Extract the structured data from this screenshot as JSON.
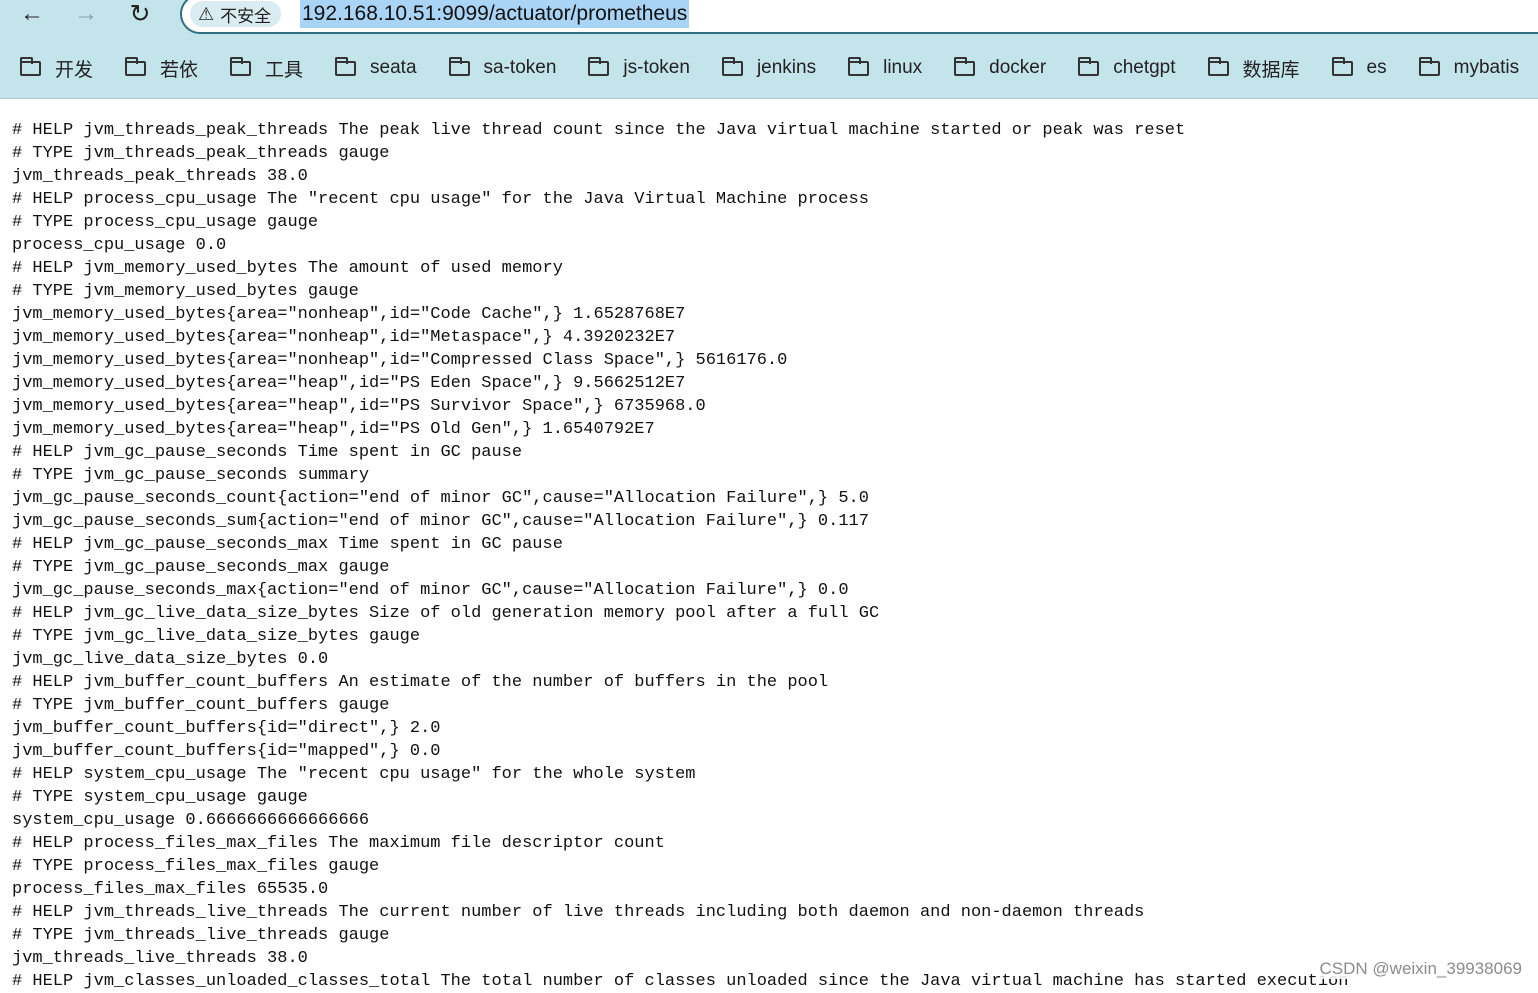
{
  "browser": {
    "url": "192.168.10.51:9099/actuator/prometheus",
    "security_label": "不安全",
    "bookmarks": [
      "开发",
      "若依",
      "工具",
      "seata",
      "sa-token",
      "js-token",
      "jenkins",
      "linux",
      "docker",
      "chetgpt",
      "数据库",
      "es",
      "mybatis"
    ]
  },
  "icons": {
    "back": "arrow-left-icon",
    "forward": "arrow-right-icon",
    "reload": "reload-icon",
    "security": "warning-triangle-icon",
    "bookmark": "folder-icon"
  },
  "colors": {
    "chrome_bg": "#c4e4ec",
    "omnibox_border": "#2f6e80",
    "url_selection": "#aad4f5"
  },
  "metrics_lines": [
    "# HELP jvm_threads_peak_threads The peak live thread count since the Java virtual machine started or peak was reset",
    "# TYPE jvm_threads_peak_threads gauge",
    "jvm_threads_peak_threads 38.0",
    "# HELP process_cpu_usage The \"recent cpu usage\" for the Java Virtual Machine process",
    "# TYPE process_cpu_usage gauge",
    "process_cpu_usage 0.0",
    "# HELP jvm_memory_used_bytes The amount of used memory",
    "# TYPE jvm_memory_used_bytes gauge",
    "jvm_memory_used_bytes{area=\"nonheap\",id=\"Code Cache\",} 1.6528768E7",
    "jvm_memory_used_bytes{area=\"nonheap\",id=\"Metaspace\",} 4.3920232E7",
    "jvm_memory_used_bytes{area=\"nonheap\",id=\"Compressed Class Space\",} 5616176.0",
    "jvm_memory_used_bytes{area=\"heap\",id=\"PS Eden Space\",} 9.5662512E7",
    "jvm_memory_used_bytes{area=\"heap\",id=\"PS Survivor Space\",} 6735968.0",
    "jvm_memory_used_bytes{area=\"heap\",id=\"PS Old Gen\",} 1.6540792E7",
    "# HELP jvm_gc_pause_seconds Time spent in GC pause",
    "# TYPE jvm_gc_pause_seconds summary",
    "jvm_gc_pause_seconds_count{action=\"end of minor GC\",cause=\"Allocation Failure\",} 5.0",
    "jvm_gc_pause_seconds_sum{action=\"end of minor GC\",cause=\"Allocation Failure\",} 0.117",
    "# HELP jvm_gc_pause_seconds_max Time spent in GC pause",
    "# TYPE jvm_gc_pause_seconds_max gauge",
    "jvm_gc_pause_seconds_max{action=\"end of minor GC\",cause=\"Allocation Failure\",} 0.0",
    "# HELP jvm_gc_live_data_size_bytes Size of old generation memory pool after a full GC",
    "# TYPE jvm_gc_live_data_size_bytes gauge",
    "jvm_gc_live_data_size_bytes 0.0",
    "# HELP jvm_buffer_count_buffers An estimate of the number of buffers in the pool",
    "# TYPE jvm_buffer_count_buffers gauge",
    "jvm_buffer_count_buffers{id=\"direct\",} 2.0",
    "jvm_buffer_count_buffers{id=\"mapped\",} 0.0",
    "# HELP system_cpu_usage The \"recent cpu usage\" for the whole system",
    "# TYPE system_cpu_usage gauge",
    "system_cpu_usage 0.6666666666666666",
    "# HELP process_files_max_files The maximum file descriptor count",
    "# TYPE process_files_max_files gauge",
    "process_files_max_files 65535.0",
    "# HELP jvm_threads_live_threads The current number of live threads including both daemon and non-daemon threads",
    "# TYPE jvm_threads_live_threads gauge",
    "jvm_threads_live_threads 38.0",
    "# HELP jvm_classes_unloaded_classes_total The total number of classes unloaded since the Java virtual machine has started execution"
  ],
  "watermark": "CSDN @weixin_39938069"
}
